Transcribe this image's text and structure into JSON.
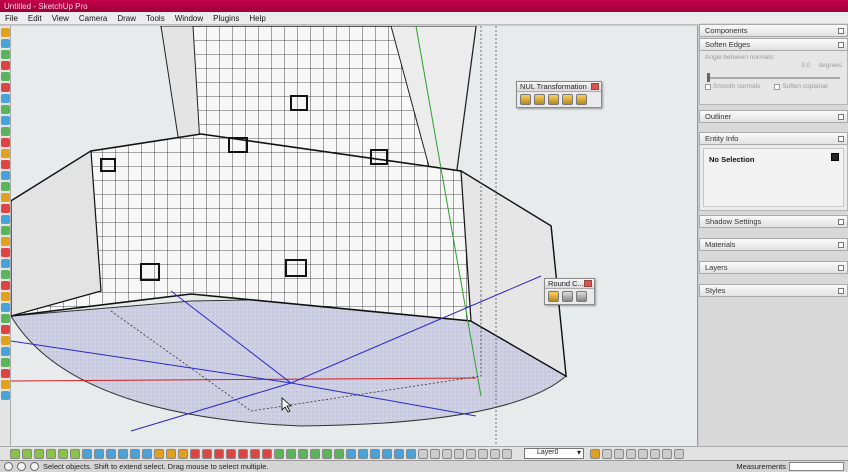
{
  "window": {
    "title": "Untitled - SketchUp Pro"
  },
  "menu": [
    "File",
    "Edit",
    "View",
    "Camera",
    "Draw",
    "Tools",
    "Window",
    "Plugins",
    "Help"
  ],
  "floating_toolbars": {
    "nul_transformation": {
      "title": "NUL Transformation",
      "icon_count": 5
    },
    "round_corner": {
      "title": "Round C...",
      "icon_count": 3
    }
  },
  "trays": {
    "components": {
      "title": "Components"
    },
    "soften_edges": {
      "title": "Soften Edges",
      "angle_label": "Angle between normals:",
      "angle_value": "0.0",
      "angle_unit": "degrees",
      "smooth_normals": "Smooth normals",
      "soften_coplanar": "Soften coplanar"
    },
    "outliner": {
      "title": "Outliner"
    },
    "entity_info": {
      "title": "Entity Info",
      "selection": "No Selection"
    },
    "shadow_settings": {
      "title": "Shadow Settings"
    },
    "materials": {
      "title": "Materials"
    },
    "layers": {
      "title": "Layers"
    },
    "styles": {
      "title": "Styles"
    }
  },
  "bottom_toolbar": {
    "layer": "Layer0"
  },
  "status": {
    "hint": "Select objects. Shift to extend select. Drag mouse to select multiple.",
    "measurements_label": "Measurements"
  },
  "colors": {
    "title_bar": "#b3003f",
    "axis_red": "#d22020",
    "axis_green": "#2aa02a",
    "axis_blue": "#2828c8"
  }
}
